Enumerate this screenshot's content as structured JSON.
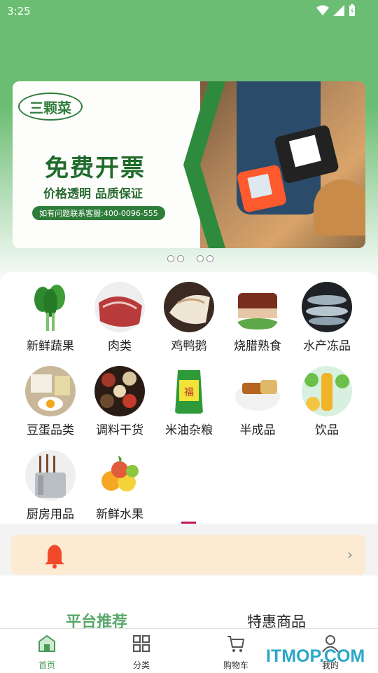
{
  "status_bar": {
    "time": "3:25"
  },
  "banner": {
    "logo_text": "三颗菜",
    "title": "免费开票",
    "subtitle": "价格透明 品质保证",
    "service_line": "如有问题联系客服:400-0096-555"
  },
  "categories": [
    {
      "label": "新鲜蔬果",
      "icon": "vegetables"
    },
    {
      "label": "肉类",
      "icon": "meat"
    },
    {
      "label": "鸡鸭鹅",
      "icon": "poultry"
    },
    {
      "label": "烧腊熟食",
      "icon": "roast-meat"
    },
    {
      "label": "水产冻品",
      "icon": "seafood"
    },
    {
      "label": "豆蛋品类",
      "icon": "tofu-eggs"
    },
    {
      "label": "调料干货",
      "icon": "spices"
    },
    {
      "label": "米油杂粮",
      "icon": "rice-oil"
    },
    {
      "label": "半成品",
      "icon": "semi-finished"
    },
    {
      "label": "饮品",
      "icon": "drinks"
    },
    {
      "label": "厨房用品",
      "icon": "kitchen-utensils"
    },
    {
      "label": "新鲜水果",
      "icon": "fruits"
    }
  ],
  "tabs": {
    "recommended": "平台推荐",
    "deals": "特惠商品"
  },
  "bottom_nav": {
    "home": "首页",
    "category": "分类",
    "cart": "购物车",
    "me": "我的"
  },
  "watermark": "ITMOP.COM",
  "colors": {
    "brand_green": "#6bbd73",
    "active_tab": "#5aa86a",
    "notice_bg": "#fcebd2",
    "bell": "#f04a2a",
    "indicator": "#c2185b"
  }
}
